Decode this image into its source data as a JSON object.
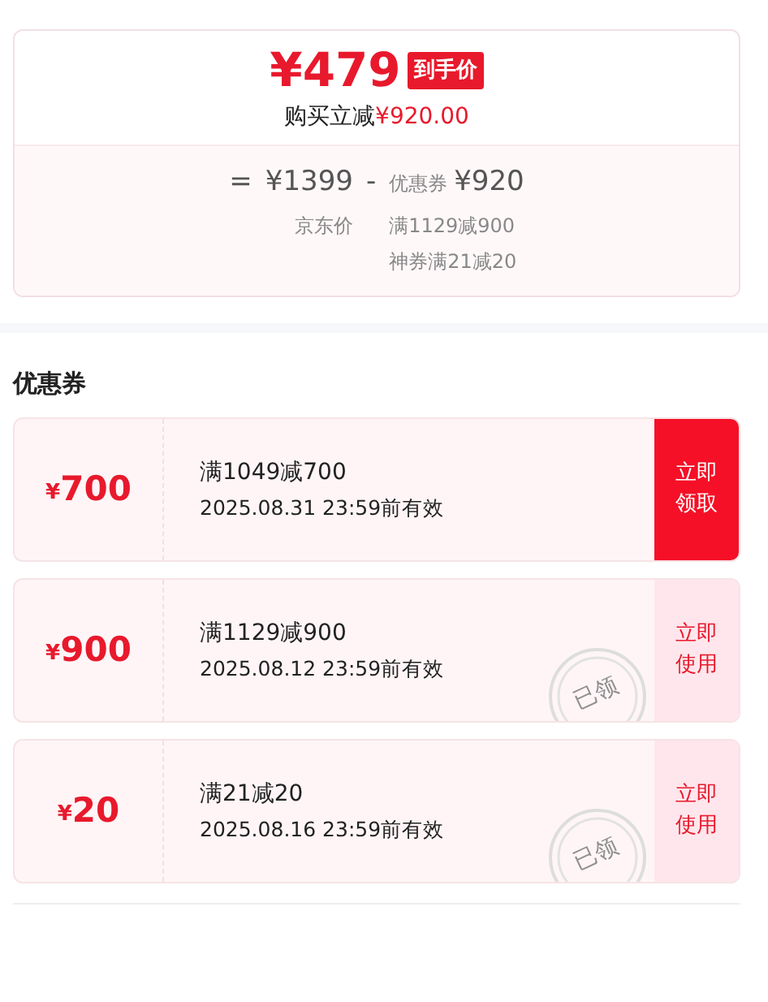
{
  "summary": {
    "price": "¥479",
    "price_tag": "到手价",
    "saving_label": "购买立减",
    "saving_amount": "¥920.00",
    "breakdown": {
      "equals": "=",
      "original_price": "¥1399",
      "original_label": "京东价",
      "minus": "-",
      "coupon_label": "优惠券",
      "coupon_total": "¥920",
      "coupon_details": [
        "满1129减900",
        "神券满21减20"
      ]
    }
  },
  "section_title": "优惠券",
  "coupons": [
    {
      "symbol": "¥",
      "amount": "700",
      "title": "满1049减700",
      "expiry": "2025.08.31 23:59前有效",
      "action": "立即领取",
      "claimed": false
    },
    {
      "symbol": "¥",
      "amount": "900",
      "title": "满1129减900",
      "expiry": "2025.08.12 23:59前有效",
      "action": "立即使用",
      "claimed": true,
      "stamp": "已领"
    },
    {
      "symbol": "¥",
      "amount": "20",
      "title": "满21减20",
      "expiry": "2025.08.16 23:59前有效",
      "action": "立即使用",
      "claimed": true,
      "stamp": "已领"
    }
  ]
}
